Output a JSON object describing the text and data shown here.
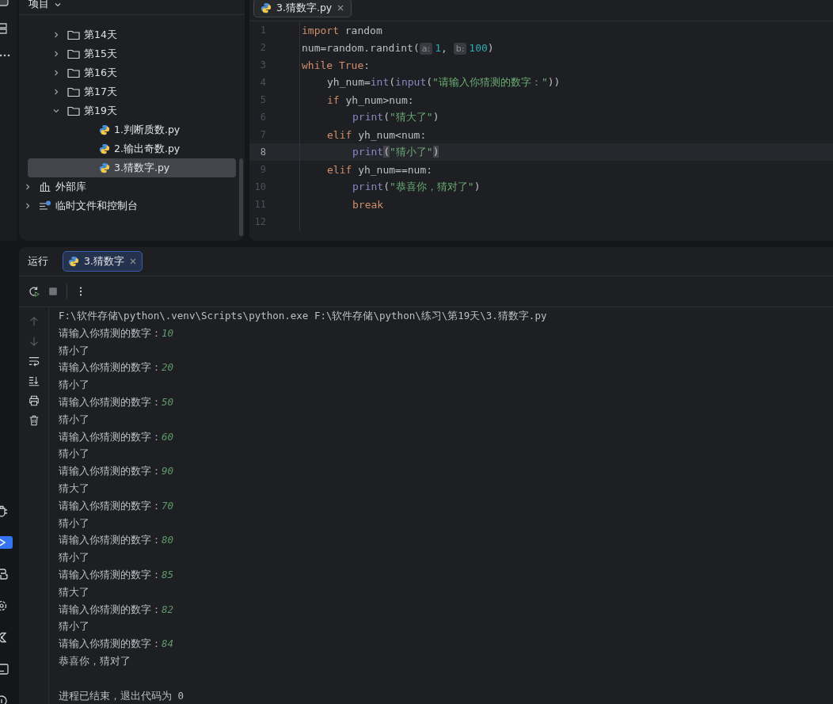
{
  "project_panel": {
    "title": "项目",
    "folders": [
      {
        "label": "第14天",
        "expanded": false
      },
      {
        "label": "第15天",
        "expanded": false
      },
      {
        "label": "第16天",
        "expanded": false
      },
      {
        "label": "第17天",
        "expanded": false
      },
      {
        "label": "第19天",
        "expanded": true,
        "children": [
          {
            "label": "1.判断质数.py",
            "selected": false
          },
          {
            "label": "2.输出奇数.py",
            "selected": false
          },
          {
            "label": "3.猜数字.py",
            "selected": true
          }
        ]
      }
    ],
    "roots": [
      {
        "kind": "library",
        "label": "外部库",
        "expanded": false
      },
      {
        "kind": "scratches",
        "label": "临时文件和控制台",
        "expanded": false
      }
    ]
  },
  "editor": {
    "tabs": [
      {
        "label": "3.猜数字.py",
        "selected": true
      }
    ],
    "lines": [
      {
        "number": "1",
        "current": false,
        "tokens": [
          {
            "kind": "kw",
            "t": "import"
          },
          {
            "kind": "plain",
            "t": " random"
          }
        ]
      },
      {
        "number": "2",
        "current": false,
        "tokens": [
          {
            "kind": "plain",
            "t": "num=random.randint("
          },
          {
            "kind": "hint",
            "t": "a:"
          },
          {
            "kind": "num",
            "t": "1"
          },
          {
            "kind": "plain",
            "t": ", "
          },
          {
            "kind": "hint",
            "t": "b:"
          },
          {
            "kind": "num",
            "t": "100"
          },
          {
            "kind": "plain",
            "t": ")"
          }
        ]
      },
      {
        "number": "3",
        "current": false,
        "tokens": [
          {
            "kind": "kw",
            "t": "while"
          },
          {
            "kind": "kw",
            "t": " True"
          },
          {
            "kind": "plain",
            "t": ":"
          }
        ],
        "children": [
          {
            "number": "4",
            "current": false,
            "tokens": [
              {
                "kind": "plain",
                "t": "yh_num="
              },
              {
                "kind": "fn",
                "t": "int"
              },
              {
                "kind": "plain",
                "t": "("
              },
              {
                "kind": "fn",
                "t": "input"
              },
              {
                "kind": "plain",
                "t": "("
              },
              {
                "kind": "str",
                "t": "\"请输入你猜测的数字：\""
              },
              {
                "kind": "plain",
                "t": "))"
              }
            ]
          },
          {
            "number": "5",
            "current": false,
            "tokens": [
              {
                "kind": "kw",
                "t": "if"
              },
              {
                "kind": "plain",
                "t": " yh_num>num:"
              }
            ],
            "children": [
              {
                "number": "6",
                "current": false,
                "tokens": [
                  {
                    "kind": "fn",
                    "t": "print"
                  },
                  {
                    "kind": "plain",
                    "t": "("
                  },
                  {
                    "kind": "str",
                    "t": "\"猜大了\""
                  },
                  {
                    "kind": "plain",
                    "t": ")"
                  }
                ]
              }
            ]
          },
          {
            "number": "7",
            "current": false,
            "tokens": [
              {
                "kind": "kw",
                "t": "elif"
              },
              {
                "kind": "plain",
                "t": " yh_num<num:"
              }
            ],
            "children": [
              {
                "number": "8",
                "current": true,
                "tokens": [
                  {
                    "kind": "fn",
                    "t": "print"
                  },
                  {
                    "kind": "brace",
                    "t": "("
                  },
                  {
                    "kind": "str",
                    "t": "\"猜小了\""
                  },
                  {
                    "kind": "brace",
                    "t": ")"
                  }
                ]
              }
            ]
          },
          {
            "number": "9",
            "current": false,
            "tokens": [
              {
                "kind": "kw",
                "t": "elif"
              },
              {
                "kind": "plain",
                "t": " yh_num==num:"
              }
            ],
            "children": [
              {
                "number": "10",
                "current": false,
                "tokens": [
                  {
                    "kind": "fn",
                    "t": "print"
                  },
                  {
                    "kind": "plain",
                    "t": "("
                  },
                  {
                    "kind": "str",
                    "t": "\"恭喜你，猜对了\""
                  },
                  {
                    "kind": "plain",
                    "t": ")"
                  }
                ]
              },
              {
                "number": "11",
                "current": false,
                "tokens": [
                  {
                    "kind": "kw",
                    "t": "break"
                  }
                ]
              }
            ]
          }
        ]
      },
      {
        "number": "12",
        "current": false
      }
    ]
  },
  "run_panel": {
    "title": "运行",
    "tabs": [
      {
        "label": "3.猜数字",
        "selected": true
      }
    ],
    "console": [
      {
        "kind": "cmd",
        "text": "F:\\软件存储\\python\\.venv\\Scripts\\python.exe F:\\软件存储\\python\\练习\\第19天\\3.猜数字.py"
      },
      {
        "kind": "prompt",
        "text": "请输入你猜测的数字：",
        "input": "10"
      },
      {
        "kind": "out",
        "text": "猜小了"
      },
      {
        "kind": "prompt",
        "text": "请输入你猜测的数字：",
        "input": "20"
      },
      {
        "kind": "out",
        "text": "猜小了"
      },
      {
        "kind": "prompt",
        "text": "请输入你猜测的数字：",
        "input": "50"
      },
      {
        "kind": "out",
        "text": "猜小了"
      },
      {
        "kind": "prompt",
        "text": "请输入你猜测的数字：",
        "input": "60"
      },
      {
        "kind": "out",
        "text": "猜小了"
      },
      {
        "kind": "prompt",
        "text": "请输入你猜测的数字：",
        "input": "90"
      },
      {
        "kind": "out",
        "text": "猜大了"
      },
      {
        "kind": "prompt",
        "text": "请输入你猜测的数字：",
        "input": "70"
      },
      {
        "kind": "out",
        "text": "猜小了"
      },
      {
        "kind": "prompt",
        "text": "请输入你猜测的数字：",
        "input": "80"
      },
      {
        "kind": "out",
        "text": "猜小了"
      },
      {
        "kind": "prompt",
        "text": "请输入你猜测的数字：",
        "input": "85"
      },
      {
        "kind": "out",
        "text": "猜大了"
      },
      {
        "kind": "prompt",
        "text": "请输入你猜测的数字：",
        "input": "82"
      },
      {
        "kind": "out",
        "text": "猜小了"
      },
      {
        "kind": "prompt",
        "text": "请输入你猜测的数字：",
        "input": "84"
      },
      {
        "kind": "out",
        "text": "恭喜你，猜对了"
      },
      {
        "kind": "blank"
      },
      {
        "kind": "exit",
        "text": "进程已结束，退出代码为 0"
      }
    ]
  }
}
